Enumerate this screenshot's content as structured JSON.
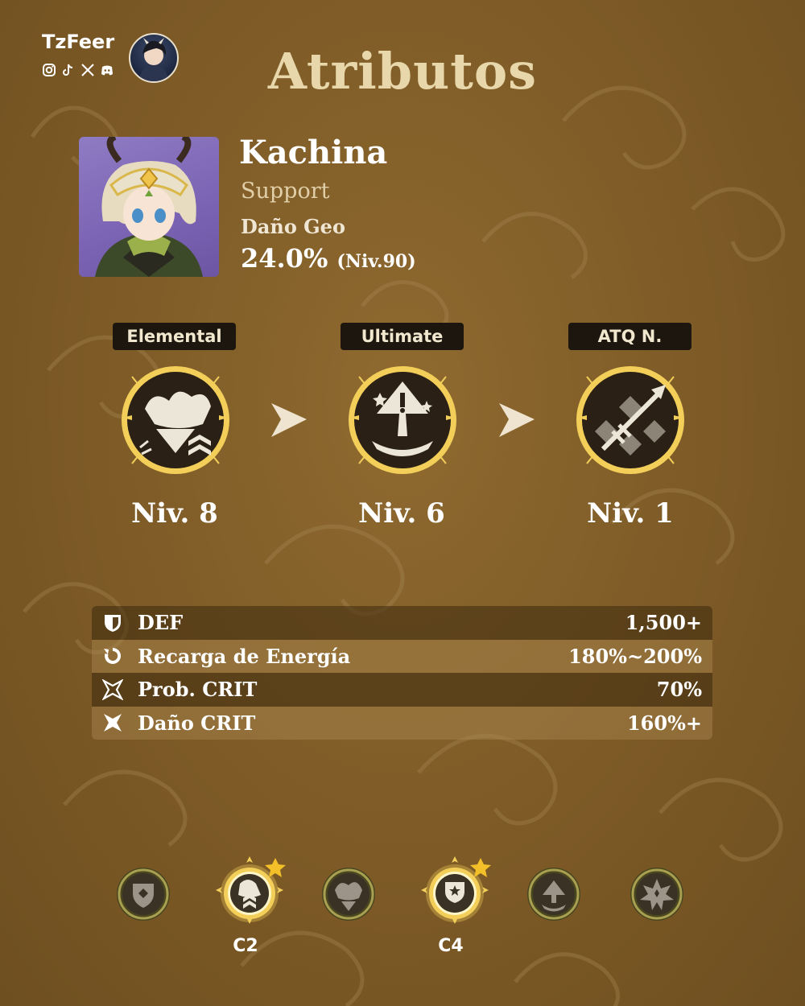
{
  "credit": {
    "name": "TzFeer",
    "social_icons": [
      "instagram-icon",
      "tiktok-icon",
      "x-icon",
      "discord-icon"
    ]
  },
  "page_title": "Atributos",
  "character": {
    "name": "Kachina",
    "role": "Support",
    "stat_label": "Daño Geo",
    "stat_value": "24.0%",
    "stat_level": "(Niv.90)"
  },
  "talents": [
    {
      "label": "Elemental",
      "level": "Niv. 8",
      "icon": "elemental-skill-icon"
    },
    {
      "label": "Ultimate",
      "level": "Niv. 6",
      "icon": "elemental-burst-icon"
    },
    {
      "label": "ATQ N.",
      "level": "Niv. 1",
      "icon": "normal-attack-icon"
    }
  ],
  "stats": [
    {
      "label": "DEF",
      "value": "1,500+",
      "icon": "defense-shield-icon"
    },
    {
      "label": "Recarga de Energía",
      "value": "180%~200%",
      "icon": "energy-recharge-icon"
    },
    {
      "label": "Prob. CRIT",
      "value": "70%",
      "icon": "crit-rate-icon"
    },
    {
      "label": "Daño CRIT",
      "value": "160%+",
      "icon": "crit-damage-icon"
    }
  ],
  "constellations": [
    {
      "label": "",
      "highlighted": false
    },
    {
      "label": "C2",
      "highlighted": true
    },
    {
      "label": "",
      "highlighted": false
    },
    {
      "label": "C4",
      "highlighted": true
    },
    {
      "label": "",
      "highlighted": false
    },
    {
      "label": "",
      "highlighted": false
    }
  ],
  "colors": {
    "background": "#7d5a26",
    "title": "#e8d7aa",
    "ring_gold": "#f3cf5a",
    "talent_label_bg": "#1c160e"
  }
}
